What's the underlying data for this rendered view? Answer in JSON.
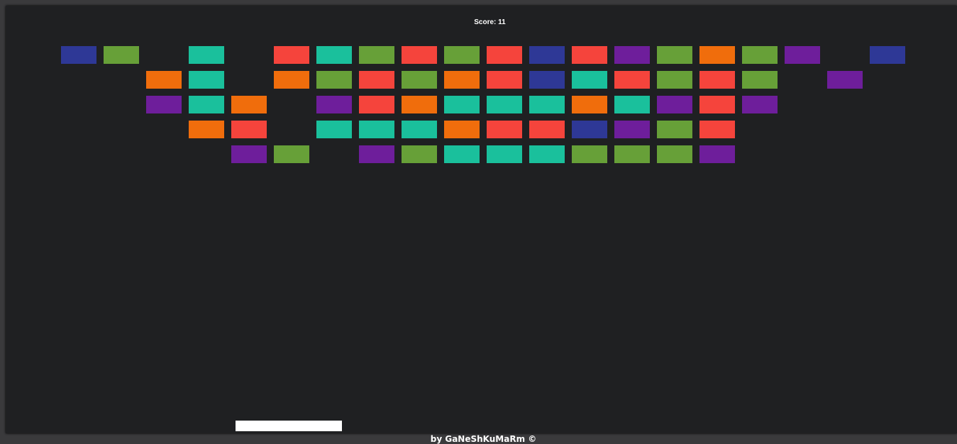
{
  "score": {
    "label": "Score:",
    "value": "11"
  },
  "credit": {
    "text": "by GaNeShKuMaRm ©"
  },
  "colors": {
    "R": "#f5443c",
    "G": "#67a038",
    "T": "#1ac09c",
    "O": "#f06d0c",
    "P": "#6e1e9b",
    "B": "#2e3896",
    "paddle": "#ffffff",
    "board": "#1f2022",
    "background": "#3a3a3c"
  },
  "bricks": {
    "columns": 20,
    "rows": [
      [
        "B",
        "G",
        ".",
        "T",
        ".",
        "R",
        "T",
        "G",
        "R",
        "G",
        "R",
        "B",
        "R",
        "P",
        "G",
        "O",
        "G",
        "P",
        ".",
        "B"
      ],
      [
        ".",
        ".",
        "O",
        "T",
        ".",
        "O",
        "G",
        "R",
        "G",
        "O",
        "R",
        "B",
        "T",
        "R",
        "G",
        "R",
        "G",
        ".",
        "P",
        "."
      ],
      [
        ".",
        ".",
        "P",
        "T",
        "O",
        ".",
        "P",
        "R",
        "O",
        "T",
        "T",
        "T",
        "O",
        "T",
        "P",
        "R",
        "P",
        ".",
        ".",
        "."
      ],
      [
        ".",
        ".",
        ".",
        "O",
        "R",
        ".",
        "T",
        "T",
        "T",
        "O",
        "R",
        "R",
        "B",
        "P",
        "G",
        "R",
        ".",
        ".",
        ".",
        "."
      ],
      [
        ".",
        ".",
        ".",
        ".",
        "P",
        "G",
        ".",
        "P",
        "G",
        "T",
        "T",
        "T",
        "G",
        "G",
        "G",
        "P",
        ".",
        ".",
        ".",
        "."
      ]
    ]
  }
}
